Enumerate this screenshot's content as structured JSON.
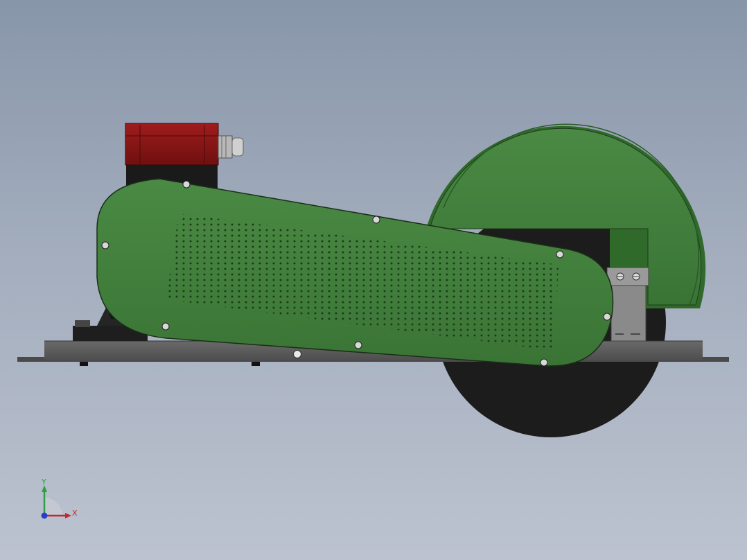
{
  "colors": {
    "background_top": "#8896aa",
    "background_bottom": "#bcc3d0",
    "guard_green": "#3f7a3a",
    "guard_green_light": "#4f8c48",
    "motor_red": "#8a1a1a",
    "base_plate": "#5a5a5a",
    "blade": "#1e1e1e",
    "axis_x": "#c0282e",
    "axis_y": "#2ea043",
    "axis_z": "#2a3fc9"
  },
  "triad": {
    "x_label": "X",
    "y_label": "Y"
  },
  "icons": {
    "triad": "coordinate-triad-icon"
  }
}
